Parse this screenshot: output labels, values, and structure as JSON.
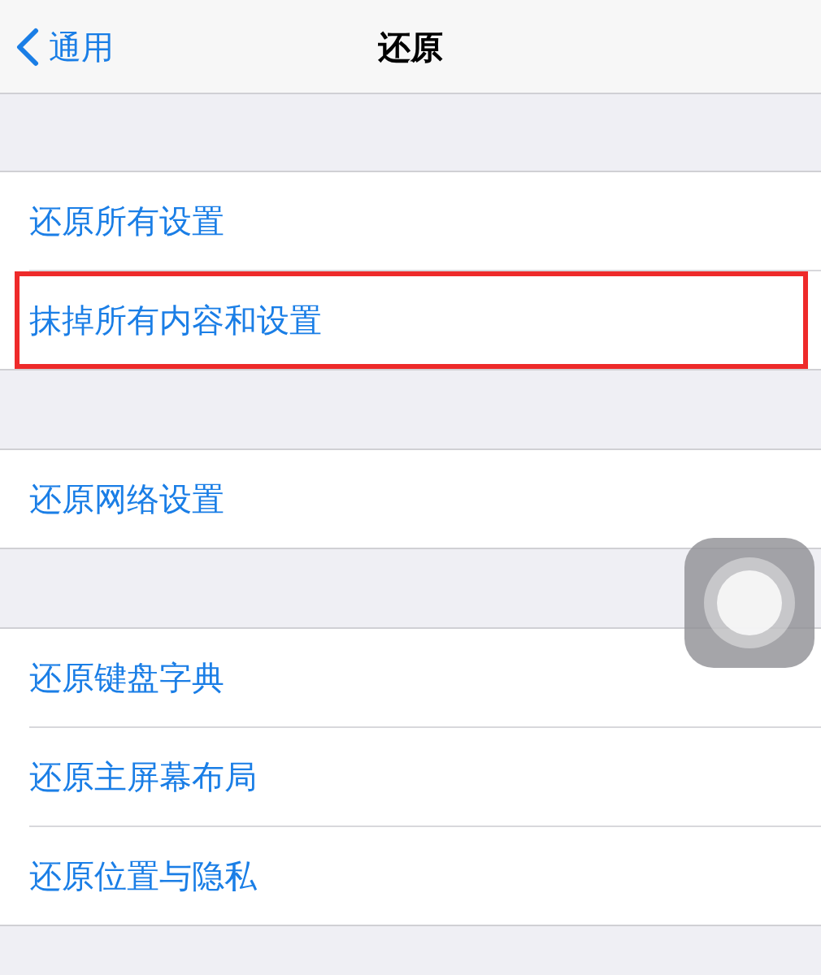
{
  "nav_bar": {
    "back_label": "通用",
    "title": "还原"
  },
  "groups": [
    {
      "rows": [
        {
          "label": "还原所有设置",
          "highlighted": false
        },
        {
          "label": "抹掉所有内容和设置",
          "highlighted": true
        }
      ]
    },
    {
      "rows": [
        {
          "label": "还原网络设置",
          "highlighted": false
        }
      ]
    },
    {
      "rows": [
        {
          "label": "还原键盘字典",
          "highlighted": false
        },
        {
          "label": "还原主屏幕布局",
          "highlighted": false
        },
        {
          "label": "还原位置与隐私",
          "highlighted": false
        }
      ]
    }
  ]
}
